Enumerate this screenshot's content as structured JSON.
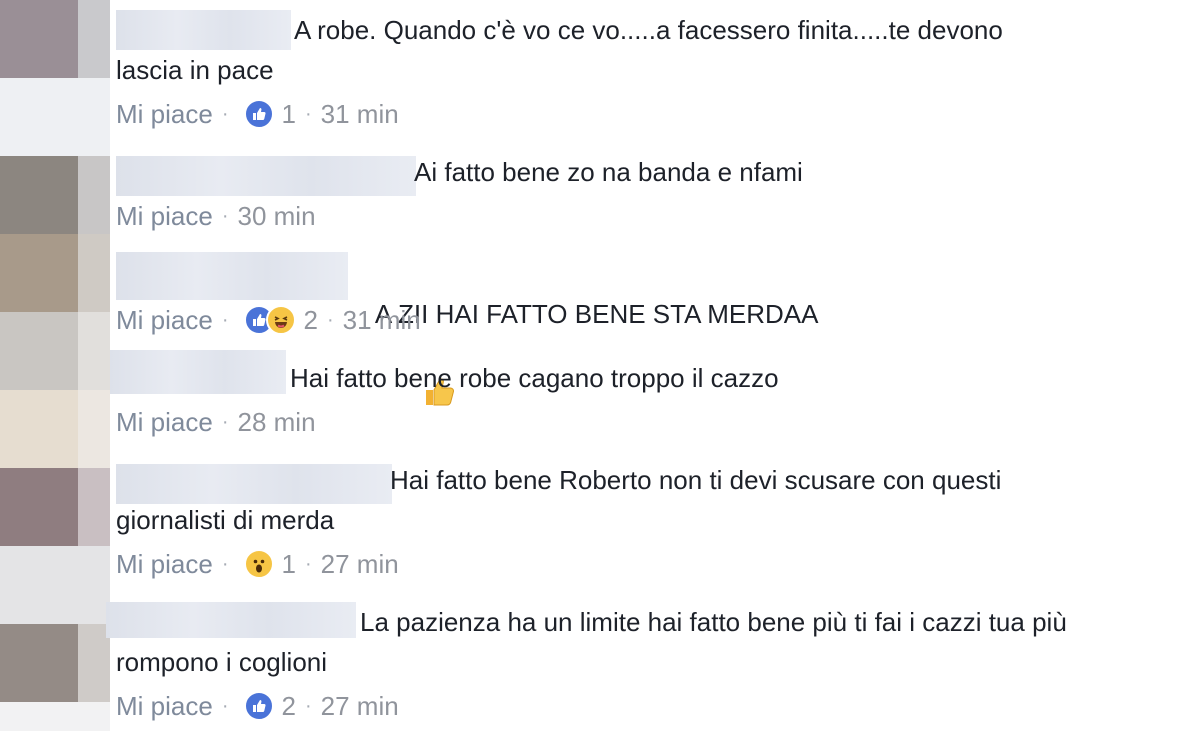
{
  "comments": [
    {
      "text": "A robe. Quando c'è vo ce vo.....a facessero finita.....te devono\nlascia in pace",
      "like_label": "Mi piace",
      "reactions": [
        "like"
      ],
      "reaction_count": "1",
      "time": "31 min"
    },
    {
      "text": "Ai fatto bene zo na banda e nfami",
      "like_label": "Mi piace",
      "reactions": [],
      "reaction_count": "",
      "time": "30 min"
    },
    {
      "text": "A ZII HAI FATTO BENE STA MERDAA",
      "like_label": "Mi piace",
      "reactions": [
        "like",
        "haha"
      ],
      "reaction_count": "2",
      "time": "31 min"
    },
    {
      "text": "Hai fatto bene robe cagano troppo il cazzo",
      "like_label": "Mi piace",
      "reactions": [],
      "reaction_count": "",
      "time": "28 min"
    },
    {
      "text": "Hai fatto bene Roberto non ti devi scusare con questi\ngiornalisti di merda",
      "like_label": "Mi piace",
      "reactions": [
        "wow"
      ],
      "reaction_count": "1",
      "time": "27 min"
    },
    {
      "text": "La pazienza ha un limite hai fatto bene più ti fai i cazzi tua più\nrompono i coglioni",
      "like_label": "Mi piace",
      "reactions": [
        "like"
      ],
      "reaction_count": "2",
      "time": "27 min"
    }
  ],
  "colors": {
    "text": "#1d2129",
    "meta": "#90949c",
    "like_reaction": "#4a73d8",
    "face_reaction": "#f6c545"
  }
}
